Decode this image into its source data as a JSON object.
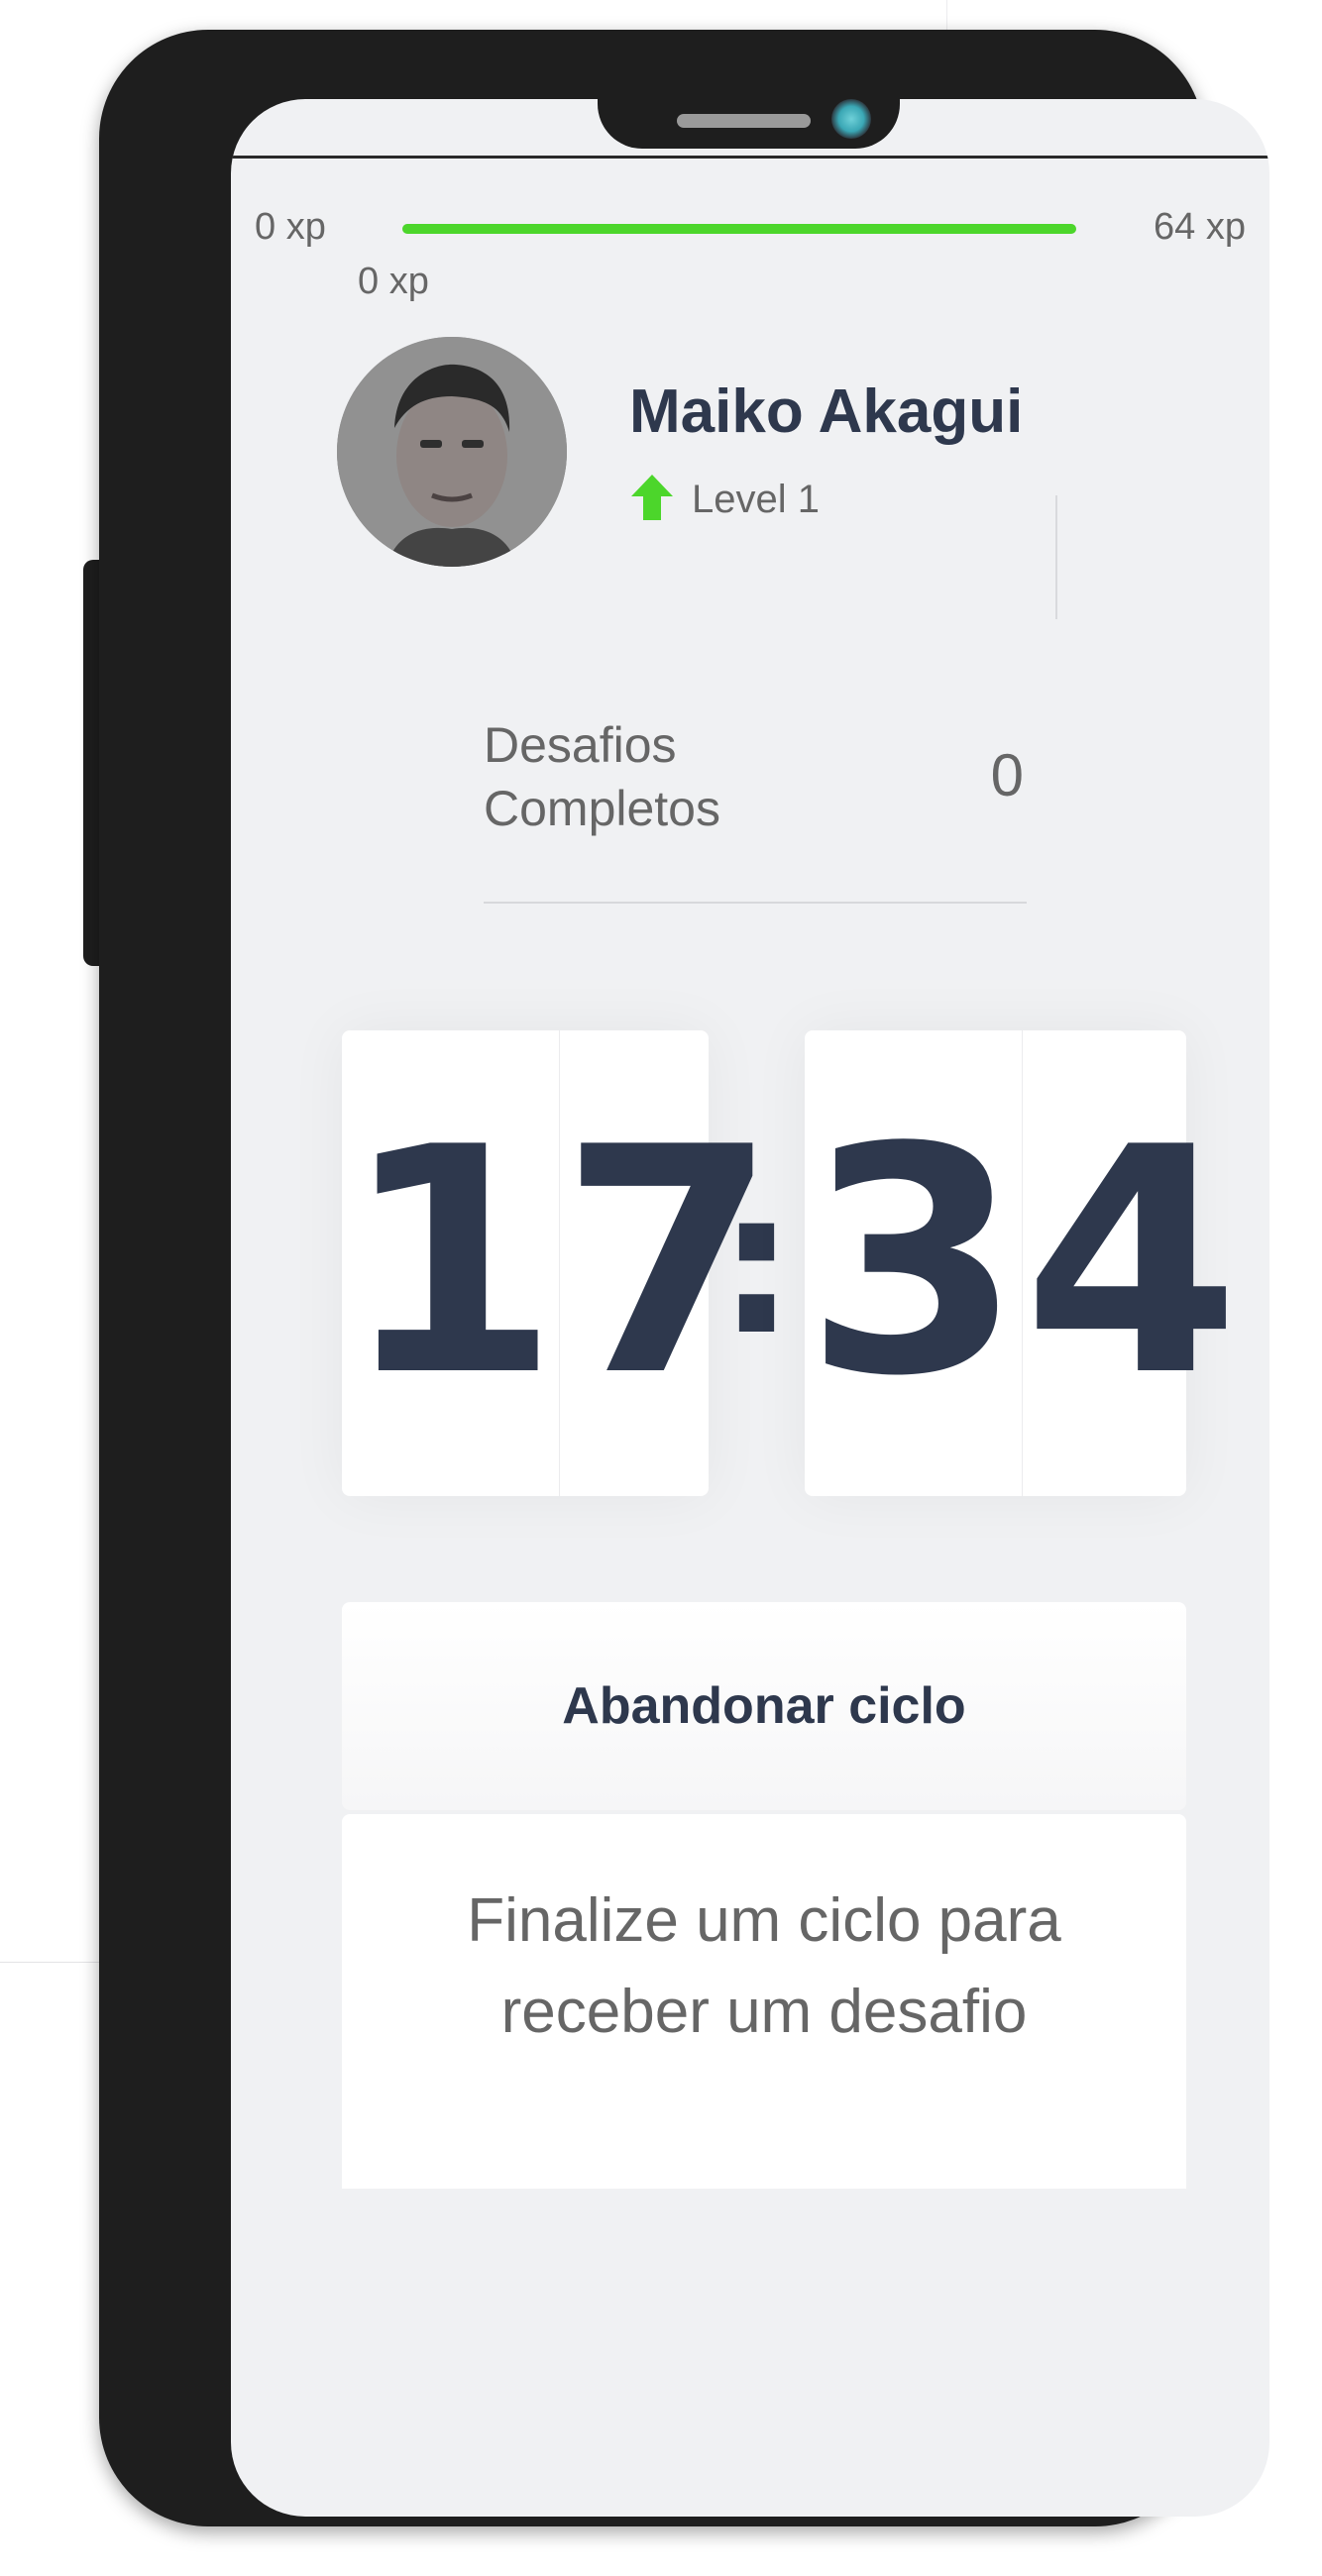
{
  "experience_bar": {
    "min_label": "0 xp",
    "max_label": "64 xp",
    "current_label": "0 xp",
    "fill_fraction": 1.0,
    "fill_color": "#4cd62b"
  },
  "profile": {
    "name": "Maiko Akagui",
    "level_label": "Level 1",
    "level_icon": "level-up-arrow-icon"
  },
  "stats": {
    "label_line1": "Desafios",
    "label_line2": "Completos",
    "value": "0"
  },
  "countdown": {
    "minute_left": "1",
    "minute_right": "7",
    "separator": ":",
    "second_left": "3",
    "second_right": "4"
  },
  "actions": {
    "abandon_label": "Abandonar ciclo"
  },
  "challenge_box": {
    "line1": "Finalize um ciclo para",
    "line2": "receber um desafio"
  },
  "colors": {
    "primary_text": "#2e384d",
    "secondary_text": "#666666",
    "background": "#f0f1f3",
    "green": "#4cd62b"
  }
}
